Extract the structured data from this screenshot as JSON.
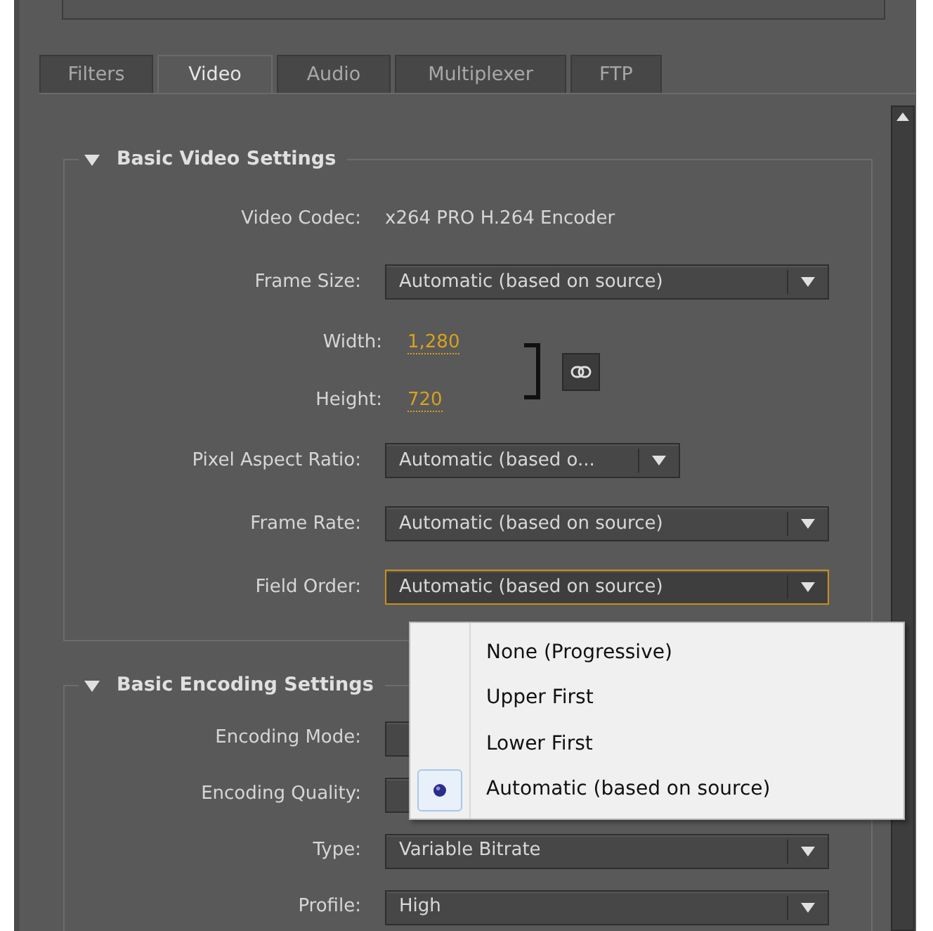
{
  "tabs": [
    {
      "label": "Filters",
      "selected": false
    },
    {
      "label": "Video",
      "selected": true
    },
    {
      "label": "Audio",
      "selected": false
    },
    {
      "label": "Multiplexer",
      "selected": false
    },
    {
      "label": "FTP",
      "selected": false
    }
  ],
  "sections": [
    {
      "title": "Basic Video Settings",
      "expanded": true,
      "rows": [
        {
          "kind": "info",
          "label": "Video Codec:",
          "value": "x264 PRO H.264 Encoder"
        },
        {
          "kind": "select",
          "label": "Frame Size:",
          "value": "Automatic (based on source)",
          "focused": false
        },
        {
          "kind": "dimensions",
          "width_label": "Width:",
          "width_value": "1,280",
          "height_label": "Height:",
          "height_value": "720"
        },
        {
          "kind": "select_short",
          "label": "Pixel Aspect Ratio:",
          "value": "Automatic (based o...",
          "focused": false
        },
        {
          "kind": "select",
          "label": "Frame Rate:",
          "value": "Automatic (based on source)",
          "focused": false
        },
        {
          "kind": "select",
          "label": "Field Order:",
          "value": "Automatic (based on source)",
          "focused": true
        }
      ]
    },
    {
      "title": "Basic Encoding Settings",
      "expanded": true,
      "rows": [
        {
          "kind": "select",
          "label": "Encoding Mode:",
          "focused": false
        },
        {
          "kind": "select",
          "label": "Encoding Quality:",
          "focused": false
        },
        {
          "kind": "select",
          "label": "Type:",
          "value": "Variable Bitrate",
          "focused": false
        },
        {
          "kind": "select",
          "label": "Profile:",
          "value": "High",
          "focused": false
        }
      ]
    }
  ],
  "dropdown_menu": {
    "items": [
      {
        "label": "None (Progressive)",
        "selected": false
      },
      {
        "label": "Upper First",
        "selected": false
      },
      {
        "label": "Lower First",
        "selected": false
      },
      {
        "label": "Automatic (based on source)",
        "selected": true
      }
    ]
  }
}
